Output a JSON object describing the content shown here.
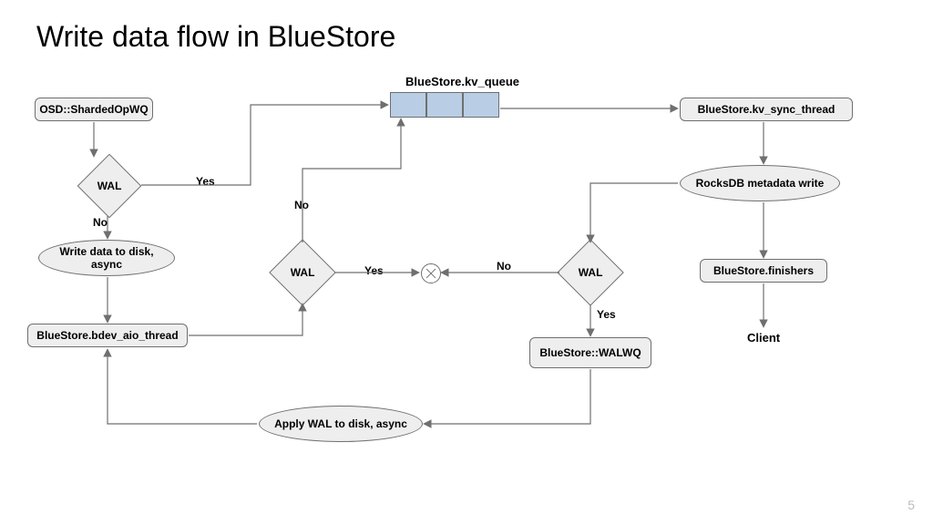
{
  "title": "Write data flow in BlueStore",
  "page_number": "5",
  "queue_label": "BlueStore.kv_queue",
  "nodes": {
    "osd_wq": "OSD::ShardedOpWQ",
    "wal1": "WAL",
    "write_async": "Write data to disk, async",
    "aio_thread": "BlueStore.bdev_aio_thread",
    "wal2": "WAL",
    "wal3": "WAL",
    "walwq": "BlueStore::WALWQ",
    "apply_wal": "Apply WAL to disk, async",
    "kv_sync": "BlueStore.kv_sync_thread",
    "rocks_write": "RocksDB metadata write",
    "finishers": "BlueStore.finishers",
    "client": "Client"
  },
  "labels": {
    "yes": "Yes",
    "no": "No"
  }
}
